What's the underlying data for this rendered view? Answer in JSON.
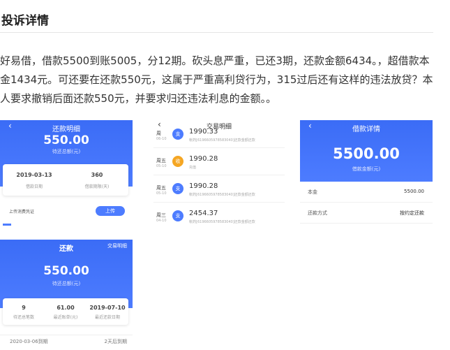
{
  "page": {
    "title": "投诉详情",
    "description": "好易借，借款5500到账5005，分12期。砍头息严重，已还3期，还款金额6434。，超借款本金1434元。可还要在还款550元，这属于严重高利贷行为，315过后还有这样的违法放贷？本人要求撤销后面还款550元，并要求归还违法利息的金额。。"
  },
  "shot_repay_detail": {
    "header_title": "还款明细",
    "amount": "550.00",
    "amount_label": "待还总额(元)",
    "date_value": "2019-03-13",
    "date_label": "借款日期",
    "period_value": "360",
    "period_label": "借款期限(天)",
    "upload_label": "上传消费凭证",
    "upload_button": "上传"
  },
  "shot_repay": {
    "header_title": "还款",
    "header_right": "交易明细",
    "amount": "550.00",
    "amount_label": "待还总额(元)",
    "stat1_value": "9",
    "stat1_label": "待还总笔数",
    "stat2_value": "61.00",
    "stat2_label": "最近账单(元)",
    "stat3_value": "2019-07-10",
    "stat3_label": "最近还款日期",
    "footer_left": "2020-03-06到期",
    "footer_right": "2天后到期"
  },
  "shot_transactions": {
    "header_title": "交易明细",
    "rows": [
      {
        "day": "周",
        "date": "06-10",
        "icon": "支",
        "amount": "1990.33",
        "sub": "帐药[6196605978583040]还款金额还款"
      },
      {
        "day": "周五",
        "date": "05-10",
        "icon": "收",
        "amount": "1990.28",
        "sub": "充值"
      },
      {
        "day": "周五",
        "date": "05-10",
        "icon": "支",
        "amount": "1990.28",
        "sub": "帐药[6196605978583040]还款金额还款"
      },
      {
        "day": "周三",
        "date": "04-10",
        "icon": "支",
        "amount": "2454.37",
        "sub": "帐药[6196605978583040]还款金额还款"
      }
    ]
  },
  "shot_loan_detail": {
    "header_title": "借款详情",
    "amount": "5500.00",
    "amount_label": "借款金额(元)",
    "principal_label": "本金",
    "principal_value": "5500.00",
    "method_label": "还款方式",
    "method_value": "按约定还款"
  },
  "colors": {
    "brand_blue": "#4d7cff",
    "expense_icon": "#4d7cff",
    "income_icon": "#f5a623"
  }
}
